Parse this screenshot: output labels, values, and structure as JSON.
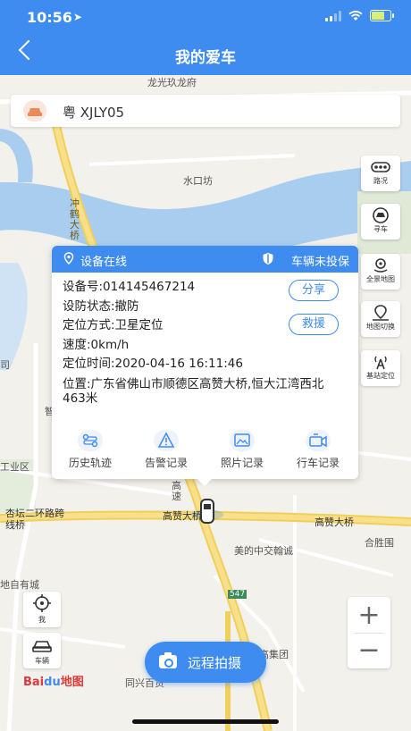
{
  "status": {
    "time": "10:56",
    "location_icon": "location-arrow-icon"
  },
  "nav": {
    "title": "我的爱车"
  },
  "vehicle": {
    "plate": "粤 XJLY05"
  },
  "map_labels": {
    "l1": "龙光玖龙府",
    "l2": "水口坊",
    "l3": "冲鹤大桥",
    "l4": "高赞大桥",
    "l5": "高赞大桥",
    "l6": "美的中交翰诚",
    "l7": "合胜围",
    "l8": "杏坛二环路跨线桥",
    "l9": "工业区",
    "l10": "地自有城",
    "l11": "同兴百货",
    "l12": "高集团",
    "l13": "547",
    "l14": "高速",
    "l15": "智",
    "l16": "司"
  },
  "tools": [
    {
      "label": "路况",
      "icon": "traffic-icon"
    },
    {
      "label": "寻车",
      "icon": "find-car-icon"
    },
    {
      "label": "全景地图",
      "icon": "panorama-icon"
    },
    {
      "label": "地图切换",
      "icon": "map-switch-icon"
    },
    {
      "label": "基站定位",
      "icon": "base-station-icon"
    }
  ],
  "popup": {
    "status_online": "设备在线",
    "status_armed": "车辆未投保",
    "device_no": "设备号:014145467214",
    "defense": "设防状态:撤防",
    "locate_mode": "定位方式:卫星定位",
    "speed": "速度:0km/h",
    "locate_time": "定位时间:2020-04-16 16:11:46",
    "address": "位置:广东省佛山市顺德区高赞大桥,恒大江湾西北463米",
    "share_label": "分享",
    "rescue_label": "救援",
    "actions": [
      {
        "label": "历史轨迹",
        "icon": "history-track-icon"
      },
      {
        "label": "告警记录",
        "icon": "alarm-icon"
      },
      {
        "label": "照片记录",
        "icon": "photo-record-icon"
      },
      {
        "label": "行车记录",
        "icon": "dashcam-icon"
      }
    ]
  },
  "controls": {
    "me_label": "我",
    "vehicle_label": "车辆",
    "zoom_in": "+",
    "zoom_out": "−"
  },
  "remote_photo": {
    "label": "远程拍摄"
  },
  "brand": {
    "logo_text": "Bai地图"
  },
  "colors": {
    "primary": "#3f8cf0",
    "road_major": "#f5d76e",
    "water": "#a9cdee"
  }
}
